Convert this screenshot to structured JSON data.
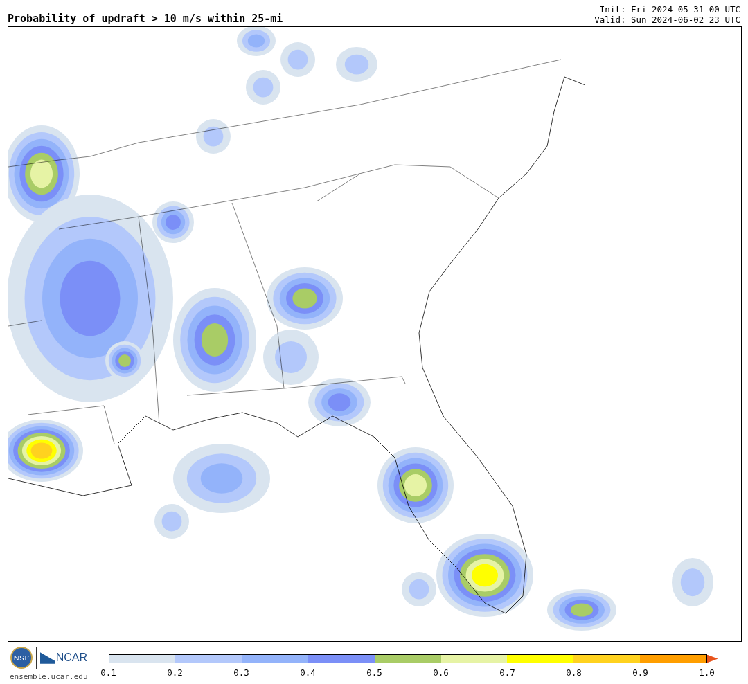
{
  "header": {
    "title": "Probability of updraft > 10 m/s within 25-mi",
    "init": "Init: Fri 2024-05-31 00 UTC",
    "valid": "Valid: Sun 2024-06-02 23 UTC"
  },
  "footer": {
    "nsf_logo": "NSF",
    "ncar_logo": "NCAR",
    "url": "ensemble.ucar.edu"
  },
  "colorbar": {
    "bins": [
      {
        "color": "#d9e4ef"
      },
      {
        "color": "#b3c8fb"
      },
      {
        "color": "#93b3fa"
      },
      {
        "color": "#7b8ff7"
      },
      {
        "color": "#a9cc66"
      },
      {
        "color": "#e6f3a5"
      },
      {
        "color": "#ffff00"
      },
      {
        "color": "#ffd21f"
      },
      {
        "color": "#ff9e00"
      }
    ],
    "extend_arrow": {
      "color": "#e8531b"
    },
    "ticks": [
      "0.1",
      "0.2",
      "0.3",
      "0.4",
      "0.5",
      "0.6",
      "0.7",
      "0.8",
      "0.9",
      "1.0"
    ]
  }
}
